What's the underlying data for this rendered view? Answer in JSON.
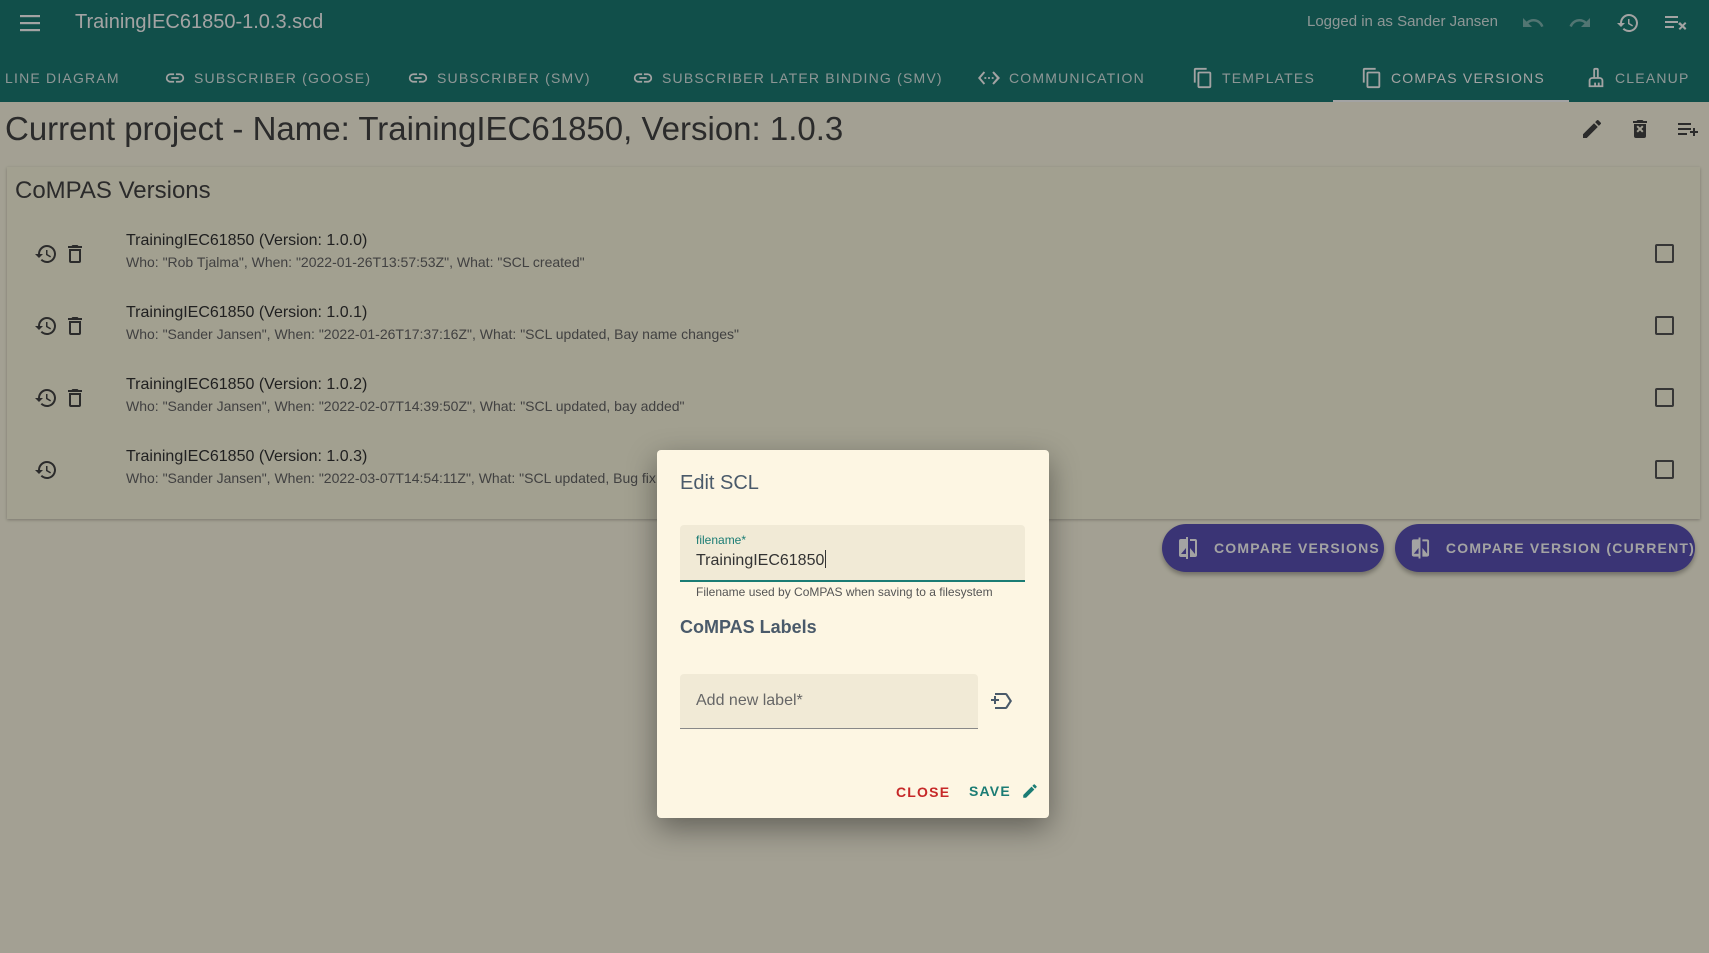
{
  "app": {
    "title": "TrainingIEC61850-1.0.3.scd",
    "logged_in": "Logged in as Sander Jansen"
  },
  "tabs": [
    {
      "label": "LINE DIAGRAM",
      "icon": "none"
    },
    {
      "label": "SUBSCRIBER (GOOSE)",
      "icon": "link-icon"
    },
    {
      "label": "SUBSCRIBER (SMV)",
      "icon": "link-icon"
    },
    {
      "label": "SUBSCRIBER LATER BINDING (SMV)",
      "icon": "link-icon"
    },
    {
      "label": "COMMUNICATION",
      "icon": "settings-ethernet-icon"
    },
    {
      "label": "TEMPLATES",
      "icon": "copy-icon"
    },
    {
      "label": "COMPAS VERSIONS",
      "icon": "copy-icon",
      "active": true
    },
    {
      "label": "CLEANUP",
      "icon": "cleaning-brush-icon"
    }
  ],
  "project": {
    "title": "Current project - Name: TrainingIEC61850, Version: 1.0.3"
  },
  "versions_card": {
    "title": "CoMPAS Versions",
    "items": [
      {
        "primary": "TrainingIEC61850 (Version: 1.0.0)",
        "secondary": "Who: \"Rob Tjalma\", When: \"2022-01-26T13:57:53Z\", What: \"SCL created\""
      },
      {
        "primary": "TrainingIEC61850 (Version: 1.0.1)",
        "secondary": "Who: \"Sander Jansen\", When: \"2022-01-26T17:37:16Z\", What: \"SCL updated, Bay name changes\""
      },
      {
        "primary": "TrainingIEC61850 (Version: 1.0.2)",
        "secondary": "Who: \"Sander Jansen\", When: \"2022-02-07T14:39:50Z\", What: \"SCL updated, bay added\""
      },
      {
        "primary": "TrainingIEC61850 (Version: 1.0.3)",
        "secondary": "Who: \"Sander Jansen\", When: \"2022-03-07T14:54:11Z\", What: \"SCL updated, Bug fix"
      }
    ]
  },
  "buttons": {
    "compare_versions": "COMPARE VERSIONS",
    "compare_version_current": "COMPARE VERSION (CURRENT)"
  },
  "dialog": {
    "title": "Edit SCL",
    "filename_label": "filename*",
    "filename_value": "TrainingIEC61850",
    "filename_helper": "Filename used by CoMPAS when saving to a filesystem",
    "labels_title": "CoMPAS Labels",
    "new_label_placeholder": "Add new label*",
    "close": "CLOSE",
    "save": "SAVE"
  },
  "colors": {
    "primary": "#1b7c74",
    "secondary": "#5b52b8",
    "close": "#c62828"
  }
}
